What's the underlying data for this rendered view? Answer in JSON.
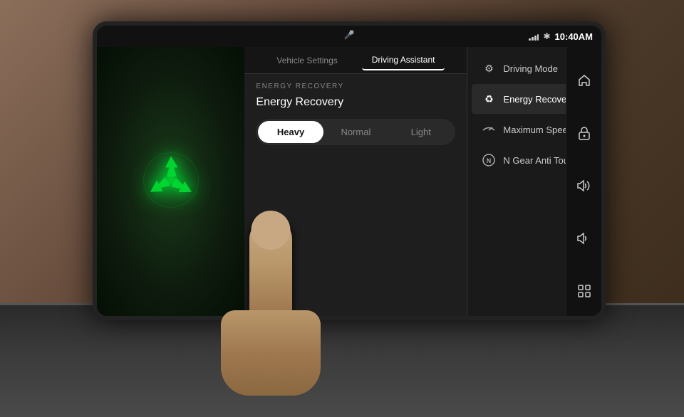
{
  "screen": {
    "statusBar": {
      "time": "10:40AM",
      "btIcon": "⬡",
      "signalIcon": "signal"
    },
    "centerIcon": "🎙",
    "tabs": [
      {
        "id": "vehicle-settings",
        "label": "Vehicle Settings",
        "active": false
      },
      {
        "id": "driving-assistant",
        "label": "Driving Assistant",
        "active": true
      }
    ],
    "settingsPanel": {
      "sectionLabel": "ENERGY RECOVERY",
      "settingTitle": "Energy Recovery",
      "toggleOptions": [
        {
          "id": "heavy",
          "label": "Heavy",
          "active": true
        },
        {
          "id": "normal",
          "label": "Normal",
          "active": false
        },
        {
          "id": "light",
          "label": "Light",
          "active": false
        }
      ]
    },
    "menuItems": [
      {
        "id": "driving-mode",
        "label": "Driving Mode",
        "icon": "⚙",
        "active": false
      },
      {
        "id": "energy-recovery",
        "label": "Energy Recovery",
        "icon": "♻",
        "active": true
      },
      {
        "id": "maximum-speed",
        "label": "Maximum Speed",
        "icon": "🏎",
        "active": false
      },
      {
        "id": "n-gear-anti-touch",
        "label": "N Gear Anti Touch",
        "icon": "Ⓝ",
        "active": false
      }
    ],
    "sidebarButtons": [
      {
        "id": "home",
        "icon": "⌂"
      },
      {
        "id": "lock",
        "icon": "🔒"
      },
      {
        "id": "volume-up",
        "icon": "🔊"
      },
      {
        "id": "volume-down",
        "icon": "🔉"
      },
      {
        "id": "grid",
        "icon": "⊞"
      }
    ]
  }
}
